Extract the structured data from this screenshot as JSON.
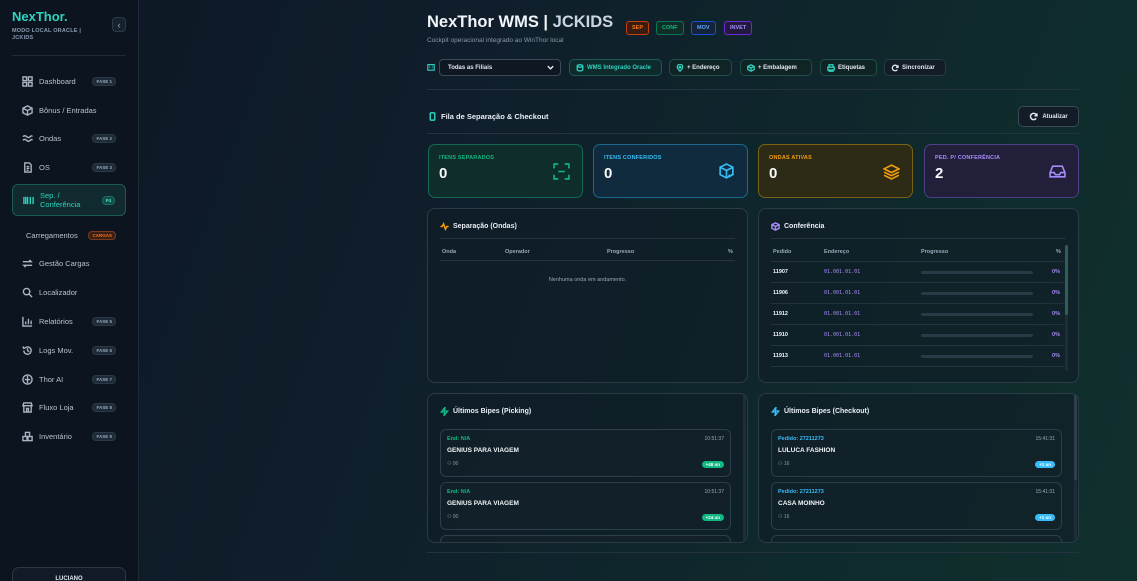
{
  "sidebar": {
    "brand": "NexThor.",
    "subtitle": "MODO LOCAL ORACLE | JCKIDS",
    "collapse_icon": "chevron-left-icon",
    "items": [
      {
        "label": "Dashboard",
        "badge": "FASE 1",
        "icon": "dashboard-icon"
      },
      {
        "label": "Bônus / Entradas",
        "badge": "",
        "icon": "package-icon"
      },
      {
        "label": "Ondas",
        "badge": "FASE 2",
        "icon": "waves-icon"
      },
      {
        "label": "OS",
        "badge": "FASE 3",
        "icon": "document-icon"
      },
      {
        "label": "Sep. / Conferência",
        "badge": "F4",
        "icon": "barcode-icon"
      },
      {
        "label": "Carregamentos",
        "badge": "CARGAS",
        "icon": ""
      },
      {
        "label": "Gestão Cargas",
        "badge": "",
        "icon": "swap-icon"
      },
      {
        "label": "Localizador",
        "badge": "",
        "icon": "search-icon"
      },
      {
        "label": "Relatórios",
        "badge": "FASE 5",
        "icon": "chart-icon"
      },
      {
        "label": "Logs Mov.",
        "badge": "FASE 6",
        "icon": "history-icon"
      },
      {
        "label": "Thor AI",
        "badge": "FASE 7",
        "icon": "bot-icon"
      },
      {
        "label": "Fluxo Loja",
        "badge": "FASE 8",
        "icon": "store-icon"
      },
      {
        "label": "Inventário",
        "badge": "FASE 9",
        "icon": "boxes-icon"
      }
    ],
    "user": "LUCIANO"
  },
  "header": {
    "title_main": "NexThor WMS |",
    "title_accent": "JCKIDS",
    "subtitle": "Cockpit operacional integrado ao WinThor local",
    "tags": [
      {
        "label": "SEP",
        "color": "#f97316"
      },
      {
        "label": "CONF",
        "color": "#10b981"
      },
      {
        "label": "MOV",
        "color": "#3b82f6"
      },
      {
        "label": "INVET",
        "color": "#8b5cf6"
      }
    ]
  },
  "toolbar": {
    "filial_select": "Todas as Filiais",
    "wms_label": "WMS Integrado Oracle",
    "endereco_label": "+ Endereço",
    "embalagem_label": "+ Embalagem",
    "etiquetas_label": "Etiquetas",
    "sincronizar_label": "Sincronizar"
  },
  "section": {
    "title": "Fila de Separação & Checkout",
    "refresh_label": "Atualizar"
  },
  "cards": [
    {
      "label": "ITENS SEPARADOS",
      "value": "0",
      "color": "#10b981",
      "icon": "scan-icon"
    },
    {
      "label": "ITENS CONFERIDOS",
      "value": "0",
      "color": "#38bdf8",
      "icon": "box-check-icon"
    },
    {
      "label": "ONDAS ATIVAS",
      "value": "0",
      "color": "#f59e0b",
      "icon": "layers-icon"
    },
    {
      "label": "PED. P/ CONFERÊNCIA",
      "value": "2",
      "color": "#a78bfa",
      "icon": "inbox-icon"
    }
  ],
  "separacao": {
    "title": "Separação (Ondas)",
    "headers": [
      "Onda",
      "Operador",
      "Progresso",
      "%"
    ],
    "empty": "Nenhuma onda em andamento."
  },
  "conferencia": {
    "title": "Conferência",
    "headers": [
      "Pedido",
      "Endereço",
      "Progresso",
      "%"
    ],
    "rows": [
      {
        "pedido": "11907",
        "endereco": "01.001.01.01",
        "pct": "0%",
        "progress": 0
      },
      {
        "pedido": "11906",
        "endereco": "01.001.01.01",
        "pct": "0%",
        "progress": 0
      },
      {
        "pedido": "11912",
        "endereco": "01.001.01.01",
        "pct": "0%",
        "progress": 0
      },
      {
        "pedido": "11910",
        "endereco": "01.001.01.01",
        "pct": "0%",
        "progress": 0
      },
      {
        "pedido": "11913",
        "endereco": "01.001.01.01",
        "pct": "0%",
        "progress": 0
      }
    ]
  },
  "bipes_picking": {
    "title": "Últimos Bipes (Picking)",
    "items": [
      {
        "head": "End: N/A",
        "time": "10:51:37",
        "name": "GENIUS PARA VIAGEM",
        "user": "90",
        "badge": "+48 un"
      },
      {
        "head": "End: N/A",
        "time": "10:51:37",
        "name": "GENIUS PARA VIAGEM",
        "user": "90",
        "badge": "+24 un"
      }
    ]
  },
  "bipes_checkout": {
    "title": "Últimos Bipes (Checkout)",
    "items": [
      {
        "head": "Pedido: 27211273",
        "time": "15:41:31",
        "name": "LULUCA FASHION",
        "user": "16",
        "badge": "+1 un"
      },
      {
        "head": "Pedido: 27211273",
        "time": "15:41:31",
        "name": "CASA MOINHO",
        "user": "16",
        "badge": "+1 un"
      }
    ]
  }
}
